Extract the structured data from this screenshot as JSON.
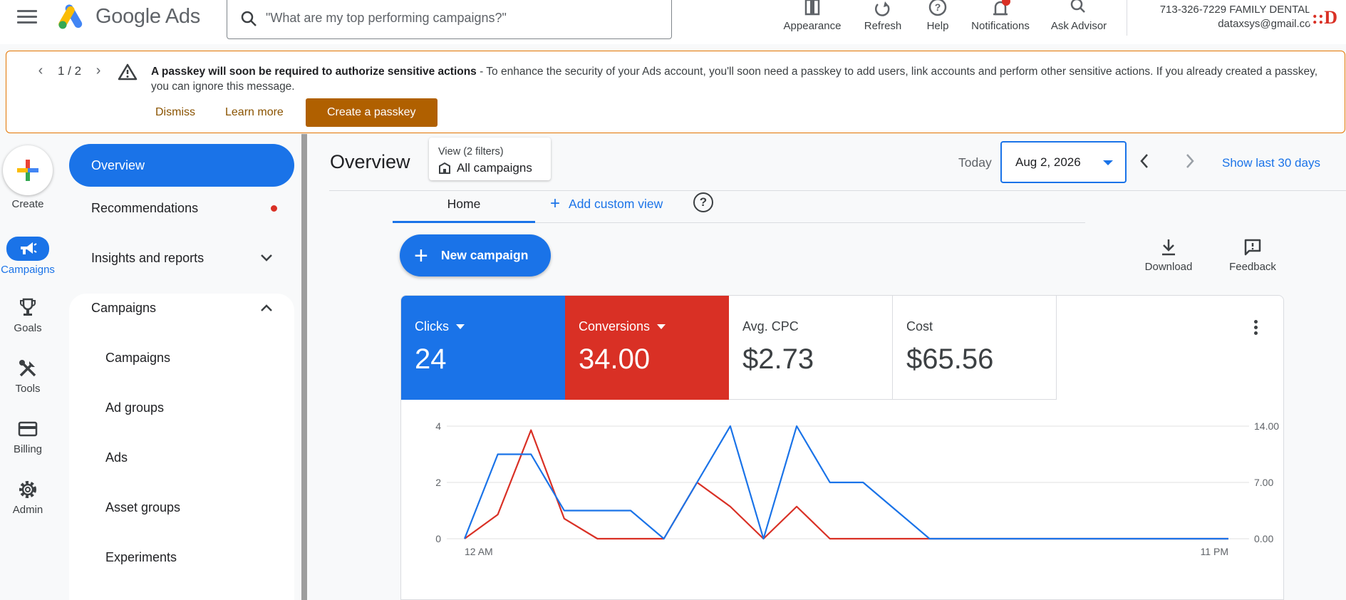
{
  "header": {
    "logo_text": "Google Ads",
    "search_placeholder": "\"What are my top performing campaigns?\"",
    "actions": [
      {
        "label": "Appearance",
        "icon": "appearance-icon"
      },
      {
        "label": "Refresh",
        "icon": "refresh-icon"
      },
      {
        "label": "Help",
        "icon": "help-icon"
      },
      {
        "label": "Notifications",
        "icon": "bell-icon"
      },
      {
        "label": "Ask Advisor",
        "icon": "advisor-icon"
      }
    ],
    "account_name": "713-326-7229 FAMILY DENTAL...",
    "account_email": "dataxsys@gmail.com",
    "avatar_text": "::D"
  },
  "banner": {
    "pager": "1 / 2",
    "title": "A passkey will soon be required to authorize sensitive actions",
    "body": " - To enhance the security of your Ads account, you'll soon need a passkey to add users, link accounts and perform other sensitive actions. If you already created a passkey, you can ignore this message.",
    "dismiss": "Dismiss",
    "learn_more": "Learn more",
    "create": "Create a passkey"
  },
  "rail": {
    "create": "Create",
    "items": [
      "Campaigns",
      "Goals",
      "Tools",
      "Billing",
      "Admin"
    ]
  },
  "nav": {
    "overview": "Overview",
    "recommendations": "Recommendations",
    "insights": "Insights and reports",
    "campaigns_group": "Campaigns",
    "sub": [
      "Campaigns",
      "Ad groups",
      "Ads",
      "Asset groups",
      "Experiments"
    ]
  },
  "main": {
    "title": "Overview",
    "view_label": "View (2 filters)",
    "view_value": "All campaigns",
    "today": "Today",
    "date": "Aug 2, 2026",
    "show_last": "Show last 30 days",
    "tab_home": "Home",
    "tab_add": "Add custom view",
    "new_campaign": "New campaign",
    "download": "Download",
    "feedback": "Feedback"
  },
  "metrics": [
    {
      "name": "Clicks",
      "value": "24",
      "style": "blue"
    },
    {
      "name": "Conversions",
      "value": "34.00",
      "style": "red"
    },
    {
      "name": "Avg. CPC",
      "value": "$2.73",
      "style": "plain"
    },
    {
      "name": "Cost",
      "value": "$65.56",
      "style": "plain"
    }
  ],
  "colors": {
    "blue": "#1a73e8",
    "red": "#d93025",
    "orange": "#b06000"
  },
  "chart_data": {
    "type": "line",
    "x": [
      "12 AM",
      "1",
      "2",
      "3",
      "4",
      "5",
      "6",
      "7",
      "8",
      "9",
      "10",
      "11",
      "12",
      "13",
      "14",
      "15",
      "16",
      "17",
      "18",
      "19",
      "20",
      "21",
      "22",
      "11 PM"
    ],
    "x_tick_labels": [
      "12 AM",
      "11 PM"
    ],
    "y_left_ticks": [
      "0",
      "2",
      "4"
    ],
    "y_right_ticks": [
      "0.00",
      "7.00",
      "14.00"
    ],
    "ylim_left": [
      0,
      4
    ],
    "ylim_right": [
      0,
      14
    ],
    "series": [
      {
        "name": "Clicks",
        "axis": "left",
        "color": "#1a73e8",
        "values": [
          0,
          3,
          3,
          1,
          1,
          1,
          0,
          2,
          4,
          0,
          4,
          2,
          2,
          1,
          0,
          0,
          0,
          0,
          0,
          0,
          0,
          0,
          0,
          0
        ]
      },
      {
        "name": "Conversions",
        "axis": "right",
        "color": "#d93025",
        "values": [
          0,
          3,
          13.5,
          2.5,
          0,
          0,
          0,
          7,
          4,
          0,
          4,
          0,
          0,
          0,
          0,
          0,
          0,
          0,
          0,
          0,
          0,
          0,
          0,
          0
        ]
      }
    ]
  }
}
